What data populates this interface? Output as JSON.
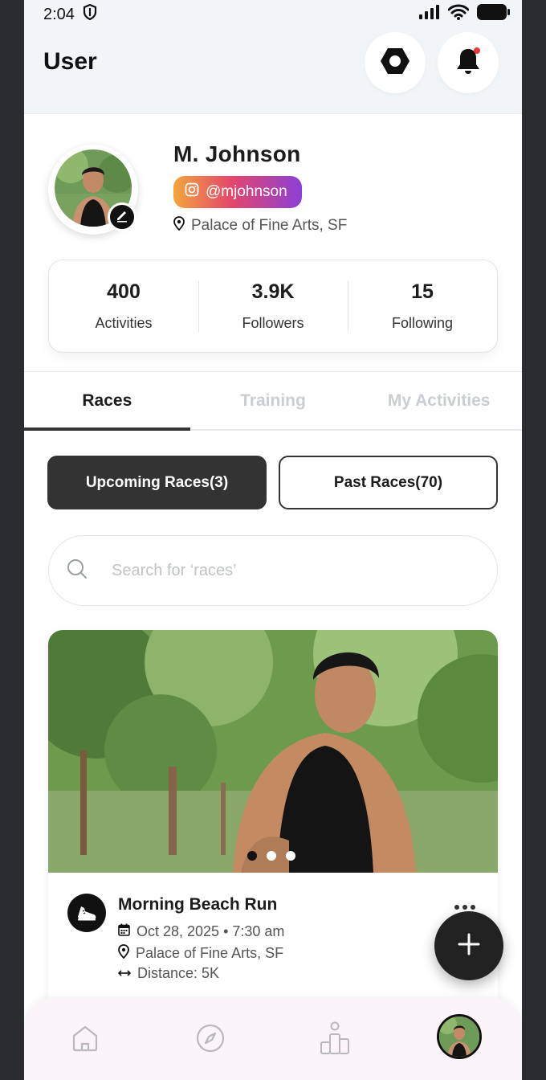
{
  "status_bar": {
    "time": "2:04",
    "icons": [
      "shield-icon",
      "signal-icon",
      "wifi-icon",
      "battery-icon"
    ]
  },
  "header": {
    "title": "User",
    "settings_icon": "hexagon-nut-icon",
    "notifications_icon": "bell-icon",
    "notification_dot_color": "#e53935"
  },
  "profile": {
    "name": "M. Johnson",
    "instagram_handle": "@mjohnson",
    "location": "Palace of Fine Arts, SF",
    "edit_icon": "pencil-icon"
  },
  "stats": [
    {
      "value": "400",
      "label": "Activities"
    },
    {
      "value": "3.9K",
      "label": "Followers"
    },
    {
      "value": "15",
      "label": "Following"
    }
  ],
  "tabs": [
    {
      "label": "Races",
      "active": true
    },
    {
      "label": "Training",
      "active": false
    },
    {
      "label": "My Activities",
      "active": false
    }
  ],
  "race_filters": {
    "upcoming_label": "Upcoming Races(3)",
    "past_label": "Past Races(70)",
    "selected": "upcoming"
  },
  "search": {
    "placeholder": "Search for ‘races’"
  },
  "race_card": {
    "title": "Morning Beach Run",
    "date_time": "Oct 28, 2025 • 7:30 am",
    "location": "Palace of Fine Arts, SF",
    "distance": "Distance: 5K",
    "carousel_total": 3,
    "carousel_active": 1,
    "icon": "running-shoe-icon"
  },
  "fab": {
    "icon": "plus-icon"
  },
  "bottom_nav": {
    "items": [
      "home-icon",
      "compass-icon",
      "leaderboard-icon",
      "profile-avatar"
    ],
    "active": "profile-avatar"
  },
  "colors": {
    "primary_dark": "#333333",
    "header_bg": "#f2f5f8",
    "bottom_nav_bg": "#fbf5fa",
    "instagram_gradient": [
      "#f2a53c",
      "#e4476b",
      "#8c3fd6"
    ]
  }
}
